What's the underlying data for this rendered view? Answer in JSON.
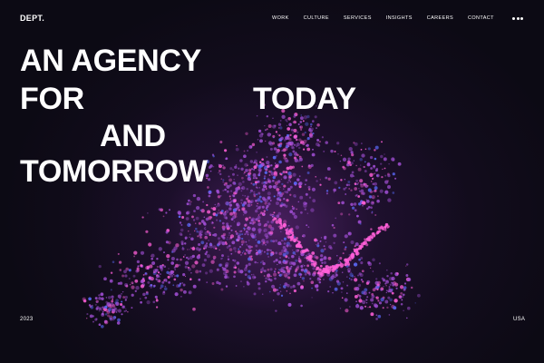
{
  "header": {
    "logo": "DEPT.",
    "nav": [
      {
        "label": "WORK"
      },
      {
        "label": "CULTURE"
      },
      {
        "label": "SERVICES"
      },
      {
        "label": "INSIGHTS"
      },
      {
        "label": "CAREERS"
      },
      {
        "label": "CONTACT"
      }
    ],
    "menu_icon": "more-dots-icon"
  },
  "hero": {
    "line1": "AN AGENCY",
    "line2_left": "FOR",
    "line2_right": "TODAY",
    "line3": "AND",
    "line4": "TOMORROW",
    "visual": "particle-cloud-artwork"
  },
  "footer": {
    "year": "2023",
    "region": "USA"
  },
  "colors": {
    "background": "#0c0a14",
    "text": "#ffffff",
    "particle_purple": "#a24fd6",
    "particle_pink": "#ff5fd8",
    "particle_blue": "#5c6cff"
  }
}
